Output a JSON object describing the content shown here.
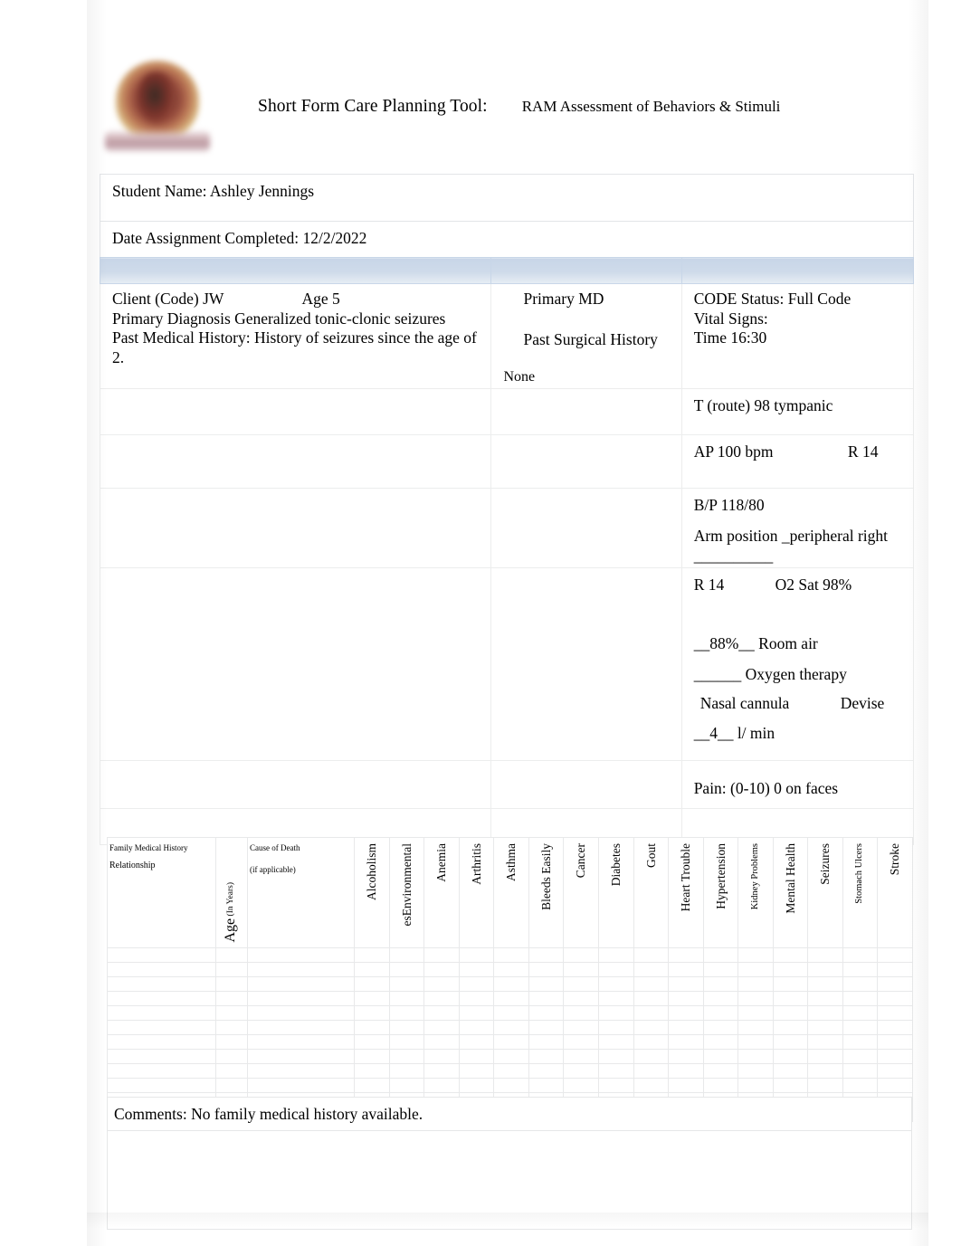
{
  "header": {
    "logo_name": "university-crest-logo",
    "title_main": "Short Form Care Planning Tool:",
    "title_sub": "RAM Assessment of Behaviors & Stimuli"
  },
  "identification": {
    "student_name_line": "Student Name: Ashley Jennings",
    "date_completed_line": "Date Assignment Completed: 12/2/2022"
  },
  "client": {
    "client_code_line": "Client  (Code)  JW",
    "age_line": "Age 5",
    "primary_diagnosis_line": "Primary Diagnosis Generalized tonic-clonic seizures",
    "past_medical_history_line": "Past Medical History: History of seizures since the age of 2."
  },
  "surgical": {
    "primary_md_label": "Primary MD",
    "past_surgical_history_label": "Past Surgical History",
    "past_surgical_history_value": "None"
  },
  "vitals": {
    "code_status": "CODE Status: Full Code",
    "vital_signs_label": "Vital Signs:",
    "time": "Time 16:30",
    "temperature": "T (route) 98 tympanic",
    "apical_pulse": "AP 100 bpm",
    "respirations_inline": "R 14",
    "blood_pressure": "B/P  118/80",
    "arm_position": "Arm position _peripheral right __________",
    "respirations": "R 14",
    "o2_sat": "O2 Sat 98%",
    "room_air": "__88%__ Room air",
    "oxygen_therapy": "______ Oxygen therapy",
    "device": "Nasal cannula",
    "device_label": "Devise",
    "flow_rate": "__4__ l/ min",
    "pain": "Pain: (0-10) 0 on faces"
  },
  "family_history": {
    "col_family_medical_history": "Family Medical History",
    "col_relationship": "Relationship",
    "col_age": "Age",
    "col_age_unit": "(In Years)",
    "col_cause_of_death": "Cause of Death",
    "col_cause_of_death_note": "(if applicable)",
    "condition_columns": [
      "Alcoholism",
      "esEnvironmental",
      "Anemia",
      "Arthritis",
      "Asthma",
      "Bleeds Easily",
      "Cancer",
      "Diabetes",
      "Gout",
      "Heart Trouble",
      "Hypertension",
      "Kidney Problems",
      "Mental Health",
      "Seizures",
      "Stomach Ulcers",
      "Stroke"
    ],
    "row_count": 12
  },
  "comments": {
    "text": "Comments: No family medical history available."
  },
  "colors": {
    "band": "#c8d6e8",
    "grid": "#e9eaec",
    "text": "#000000"
  }
}
